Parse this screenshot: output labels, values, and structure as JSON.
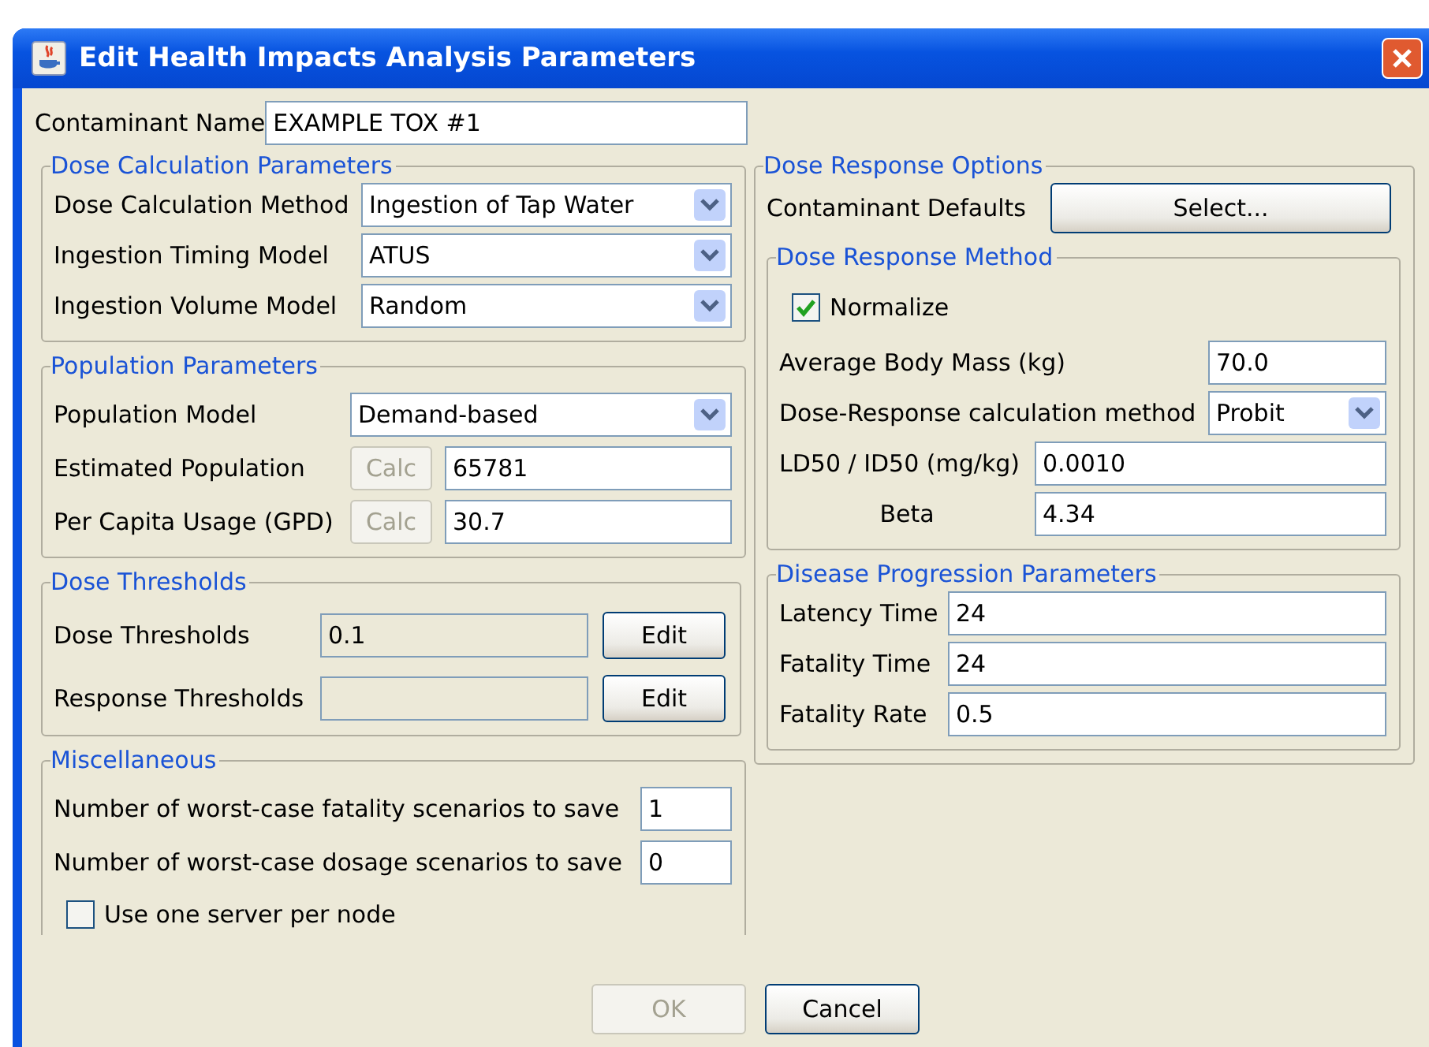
{
  "window": {
    "title": "Edit Health Impacts Analysis Parameters"
  },
  "contaminant_name": {
    "label": "Contaminant Name",
    "value": "EXAMPLE TOX #1"
  },
  "dose_calculation": {
    "title": "Dose Calculation Parameters",
    "rows": [
      {
        "kind": "dropdown",
        "label": "Dose Calculation Method",
        "value": "Ingestion of Tap Water"
      },
      {
        "kind": "dropdown",
        "label": "Ingestion Timing Model",
        "value": "ATUS"
      },
      {
        "kind": "dropdown",
        "label": "Ingestion Volume Model",
        "value": "Random"
      }
    ]
  },
  "population": {
    "title": "Population Parameters",
    "rows": [
      {
        "kind": "dropdown",
        "label": "Population Model",
        "value": "Demand-based"
      },
      {
        "kind": "calc",
        "label": "Estimated Population",
        "button": "Calc",
        "button_disabled": true,
        "value": "65781"
      },
      {
        "kind": "calc",
        "label": "Per Capita Usage (GPD)",
        "button": "Calc",
        "button_disabled": true,
        "value": "30.7"
      }
    ]
  },
  "thresholds": {
    "title": "Dose Thresholds",
    "rows": [
      {
        "kind": "edit",
        "label": "Dose Thresholds",
        "value": "0.1",
        "button": "Edit"
      },
      {
        "kind": "edit",
        "label": "Response Thresholds",
        "button": "Edit"
      }
    ]
  },
  "misc": {
    "title": "Miscellaneous",
    "rows": [
      {
        "kind": "text",
        "label": "Number of worst-case fatality scenarios to save",
        "value": "1"
      },
      {
        "kind": "text",
        "label": "Number of worst-case dosage scenarios to save",
        "value": "0"
      }
    ],
    "checkbox": {
      "label": "Use one server per node",
      "checked": false
    }
  },
  "dose_response": {
    "title": "Dose Response Options",
    "defaults": {
      "label": "Contaminant Defaults",
      "button": "Select..."
    },
    "method": {
      "title": "Dose Response Method",
      "normalize": {
        "label": "Normalize",
        "checked": true
      },
      "rows": [
        {
          "kind": "short",
          "label": "Average Body Mass (kg)",
          "value": "70.0"
        },
        {
          "kind": "dropdown",
          "label": "Dose-Response calculation method",
          "value": "Probit"
        },
        {
          "kind": "wide",
          "label": "LD50 / ID50 (mg/kg)",
          "value": "0.0010"
        },
        {
          "kind": "centered",
          "label": "Beta",
          "value": "4.34"
        }
      ]
    },
    "progression": {
      "title": "Disease Progression Parameters",
      "rows": [
        {
          "kind": "text",
          "label": "Latency Time",
          "value": "24"
        },
        {
          "kind": "text",
          "label": "Fatality Time",
          "value": "24"
        },
        {
          "kind": "text",
          "label": "Fatality Rate",
          "value": "0.5"
        }
      ]
    }
  },
  "buttons": [
    {
      "label": "OK",
      "disabled": true
    },
    {
      "label": "Cancel",
      "disabled": false
    }
  ]
}
